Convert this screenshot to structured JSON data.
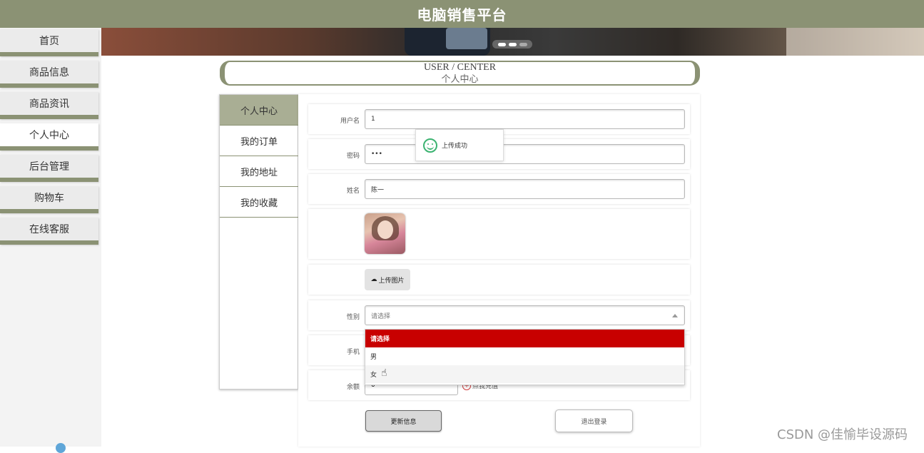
{
  "app": {
    "title": "电脑销售平台"
  },
  "nav": {
    "items": [
      {
        "label": "首页"
      },
      {
        "label": "商品信息"
      },
      {
        "label": "商品资讯"
      },
      {
        "label": "个人中心",
        "active": true
      },
      {
        "label": "后台管理"
      },
      {
        "label": "购物车"
      },
      {
        "label": "在线客服"
      }
    ]
  },
  "section": {
    "title_en": "USER / CENTER",
    "title_cn": "个人中心"
  },
  "sidetabs": [
    {
      "label": "个人中心",
      "active": true
    },
    {
      "label": "我的订单"
    },
    {
      "label": "我的地址"
    },
    {
      "label": "我的收藏"
    }
  ],
  "form": {
    "username_label": "用户名",
    "username_value": "1",
    "password_label": "密码",
    "password_value": "•••",
    "name_label": "姓名",
    "name_value": "陈一",
    "upload_label": "上传图片",
    "gender_label": "性别",
    "gender_placeholder": "请选择",
    "gender_options": [
      "请选择",
      "男",
      "女"
    ],
    "gender_highlighted": "请选择",
    "phone_label": "手机",
    "balance_label": "余额",
    "balance_value": "0",
    "recharge_label": "点我充值",
    "update_button": "更新信息",
    "logout_button": "退出登录"
  },
  "toast": {
    "message": "上传成功"
  },
  "watermark": "CSDN @佳愉毕设源码",
  "colors": {
    "brand": "#8b9274",
    "select_highlight": "#c80000",
    "success": "#3cb371"
  }
}
